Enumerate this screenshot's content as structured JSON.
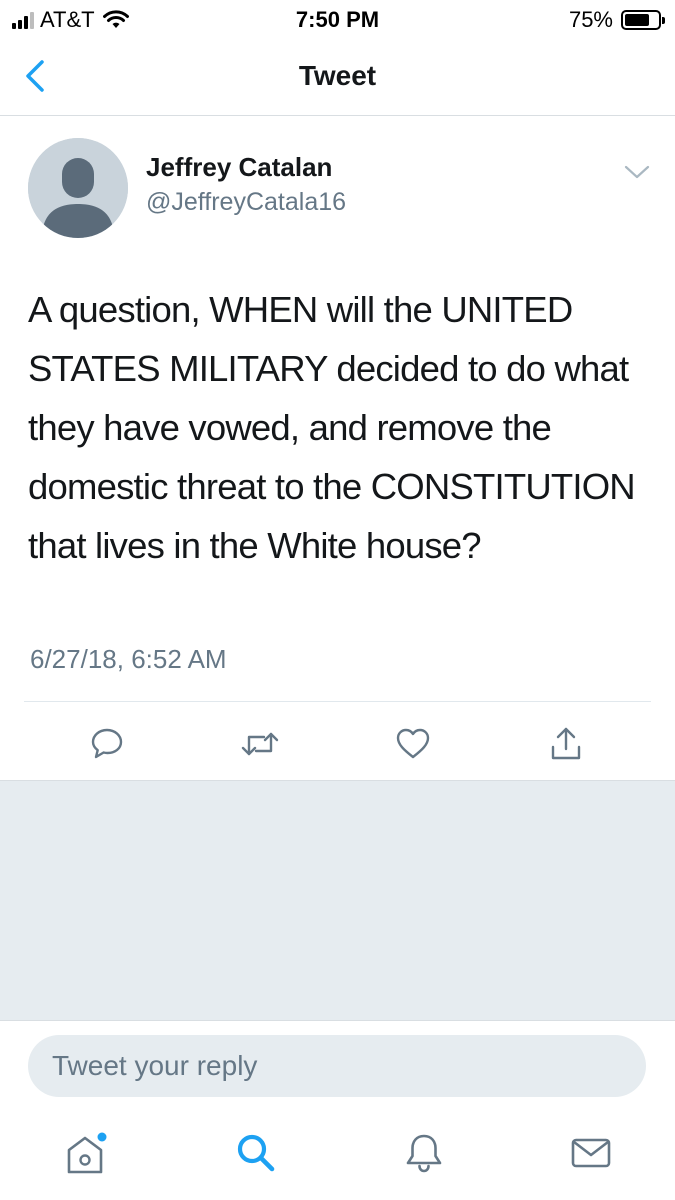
{
  "status_bar": {
    "carrier": "AT&T",
    "time": "7:50 PM",
    "battery_percent": "75%",
    "battery_level": 0.75
  },
  "nav": {
    "title": "Tweet"
  },
  "tweet": {
    "user_name": "Jeffrey Catalan",
    "user_handle": "@JeffreyCatala16",
    "text": "A question, WHEN will the UNITED STATES MILITARY decided to do what they have vowed, and remove the domestic threat to the CONSTITUTION that lives in the White house?",
    "timestamp": "6/27/18, 6:52 AM"
  },
  "reply": {
    "placeholder": "Tweet your reply"
  },
  "icons": {
    "back": "chevron-left-icon",
    "more": "chevron-down-icon",
    "reply": "speech-bubble-icon",
    "retweet": "retweet-icon",
    "like": "heart-icon",
    "share": "share-icon",
    "home": "home-icon",
    "search": "search-icon",
    "notifications": "bell-icon",
    "messages": "envelope-icon"
  },
  "colors": {
    "accent": "#1da1f2",
    "text_primary": "#14171a",
    "text_secondary": "#657786",
    "icon_gray": "#657786",
    "background_gray": "#e6ecf0"
  }
}
